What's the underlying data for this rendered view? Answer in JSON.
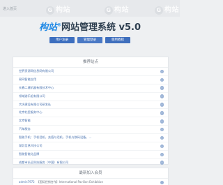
{
  "topbar": {
    "link_text": "进入首页"
  },
  "watermark": {
    "text": "构站"
  },
  "title": {
    "brand": "构站",
    "trademark": "®",
    "rest": "网站管理系统 v5.0"
  },
  "buttons": [
    {
      "label": "用户注册"
    },
    {
      "label": "管理登录"
    },
    {
      "label": "使用教程"
    }
  ],
  "recommended": {
    "header": "推荐站点",
    "items": [
      {
        "label": "世界资源网信息网有限公司"
      },
      {
        "label": "易网智能应用"
      },
      {
        "label": "长春二建机器有限技术中心"
      },
      {
        "label": "领域游乐组有限公司"
      },
      {
        "label": "大庆建设有限公司研发社"
      },
      {
        "label": "北京北里服务中心"
      },
      {
        "label": "北京智能"
      },
      {
        "label": "汽车服务"
      },
      {
        "label": "智能手机：手机话机，充值与话机，手机与数码设备，..."
      },
      {
        "label": "湖北信息科技公司"
      },
      {
        "label": "智能智能化品牌"
      },
      {
        "label": "成都市长远科技服务（中国）有限公司"
      },
      {
        "label": "a.cccs.com"
      }
    ]
  },
  "members": {
    "header": "最新加入会员",
    "rows": [
      {
        "name": "admin7972",
        "text": "【国际经销合作】International Pavilion Exhibition"
      }
    ]
  }
}
